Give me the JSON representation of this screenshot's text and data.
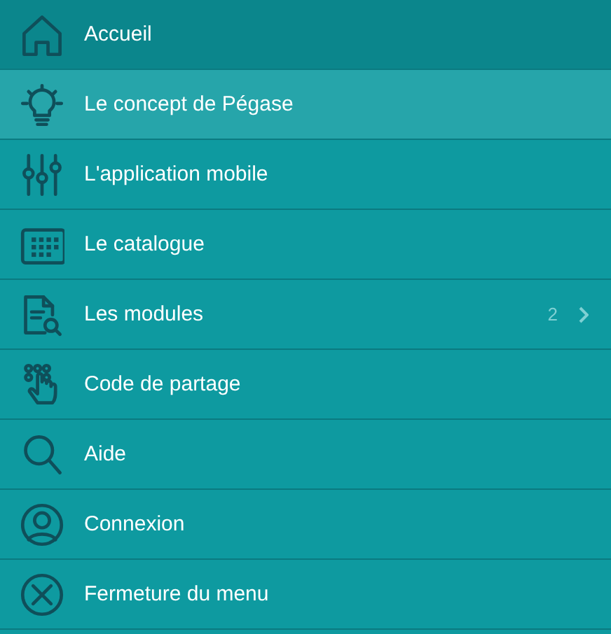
{
  "menu": {
    "items": [
      {
        "label": "Accueil",
        "current": true,
        "selected": false,
        "has_submenu": false
      },
      {
        "label": "Le concept de Pégase",
        "current": false,
        "selected": true,
        "has_submenu": false
      },
      {
        "label": "L'application mobile",
        "current": false,
        "selected": false,
        "has_submenu": false
      },
      {
        "label": "Le catalogue",
        "current": false,
        "selected": false,
        "has_submenu": false
      },
      {
        "label": "Les modules",
        "current": false,
        "selected": false,
        "has_submenu": true,
        "count": "2"
      },
      {
        "label": "Code de partage",
        "current": false,
        "selected": false,
        "has_submenu": false
      },
      {
        "label": "Aide",
        "current": false,
        "selected": false,
        "has_submenu": false
      },
      {
        "label": "Connexion",
        "current": false,
        "selected": false,
        "has_submenu": false
      },
      {
        "label": "Fermeture du menu",
        "current": false,
        "selected": false,
        "has_submenu": false
      }
    ]
  }
}
